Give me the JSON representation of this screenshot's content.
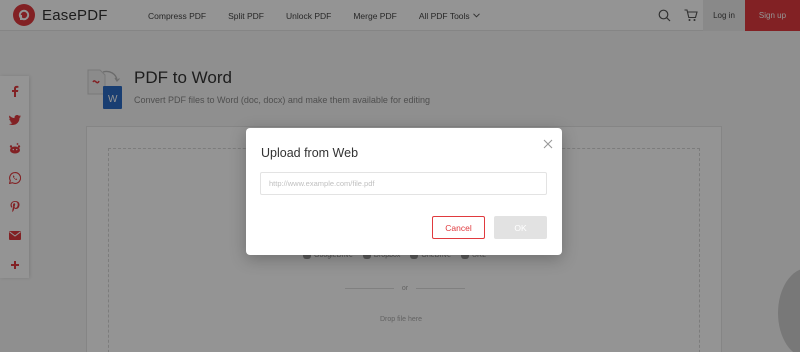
{
  "brand": {
    "name": "EasePDF",
    "color": "#e03a3e"
  },
  "nav": {
    "items": [
      {
        "label": "Compress PDF"
      },
      {
        "label": "Split PDF"
      },
      {
        "label": "Unlock PDF"
      },
      {
        "label": "Merge PDF"
      },
      {
        "label": "All PDF Tools"
      }
    ]
  },
  "header": {
    "search_icon": "search-icon",
    "cart_icon": "cart-icon",
    "login_label": "Log in",
    "signup_label": "Sign up"
  },
  "social": {
    "items": [
      {
        "name": "facebook",
        "glyph": "f"
      },
      {
        "name": "twitter",
        "glyph": "t"
      },
      {
        "name": "reddit",
        "glyph": "r"
      },
      {
        "name": "whatsapp",
        "glyph": "w"
      },
      {
        "name": "pinterest",
        "glyph": "p"
      },
      {
        "name": "email",
        "glyph": "✉"
      },
      {
        "name": "more",
        "glyph": "+"
      }
    ]
  },
  "page": {
    "title": "PDF to Word",
    "subtitle": "Convert PDF files to Word (doc, docx) and make them available for editing"
  },
  "upload": {
    "sources": [
      {
        "label": "GoogleDrive"
      },
      {
        "label": "Dropbox"
      },
      {
        "label": "OneDrive"
      },
      {
        "label": "URL"
      }
    ],
    "or_text": "or",
    "drop_text": "Drop file here"
  },
  "modal": {
    "title": "Upload from Web",
    "url_value": "",
    "url_placeholder": "http://www.example.com/file.pdf",
    "cancel_label": "Cancel",
    "ok_label": "OK"
  }
}
